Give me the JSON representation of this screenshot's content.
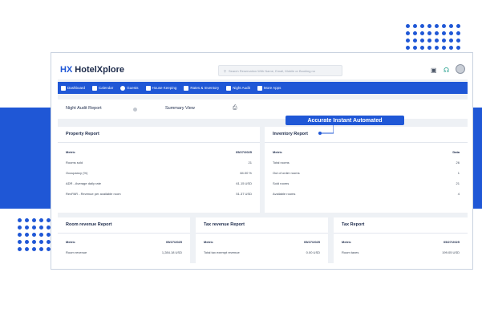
{
  "app": {
    "logo_mark": "HX",
    "name": "HotelXplore"
  },
  "search": {
    "placeholder": "Search Reservation With Name, Email, Mobile or Booking no"
  },
  "nav": {
    "items": [
      {
        "label": "Dashboard"
      },
      {
        "label": "Calendar"
      },
      {
        "label": "Guests"
      },
      {
        "label": "House Keeping"
      },
      {
        "label": "Rates & Inventory"
      },
      {
        "label": "Night Audit"
      },
      {
        "label": "More Apps"
      }
    ]
  },
  "subhead": {
    "report_title": "Night Audit Report",
    "summary_label": "Summary View"
  },
  "callout": {
    "text": "Accurate Instant Automated"
  },
  "property_report": {
    "title": "Property Report",
    "header": [
      "Metric",
      "05/27/2025"
    ],
    "rows": [
      [
        "Rooms sold",
        "21"
      ],
      [
        "Occupancy (%)",
        "84.00 %"
      ],
      [
        "ADR - Average daily rate",
        "61.15 USD"
      ],
      [
        "RevPAR - Revenue per available room",
        "51.37 USD"
      ]
    ]
  },
  "inventory_report": {
    "title": "Inventory Report",
    "header": [
      "Metric",
      "Data"
    ],
    "rows": [
      [
        "Total rooms",
        "26"
      ],
      [
        "Out of order rooms",
        "1"
      ],
      [
        "Sold rooms",
        "21"
      ],
      [
        "Available rooms",
        "4"
      ]
    ]
  },
  "room_revenue_report": {
    "title": "Room revenue Report",
    "header": [
      "Metric",
      "05/27/2025"
    ],
    "rows": [
      [
        "Room revenue",
        "1,284.18 USD"
      ]
    ]
  },
  "tax_revenue_report": {
    "title": "Tax revenue Report",
    "header": [
      "Metric",
      "05/27/2025"
    ],
    "rows": [
      [
        "Total tax exempt revenue",
        "0.00 USD"
      ]
    ]
  },
  "tax_report": {
    "title": "Tax Report",
    "header": [
      "Metric",
      "05/27/2025"
    ],
    "rows": [
      [
        "Room taxes",
        "199.05 USD"
      ]
    ]
  },
  "colors": {
    "brand_blue": "#1f57d6",
    "text_dark": "#1c2a4a"
  }
}
